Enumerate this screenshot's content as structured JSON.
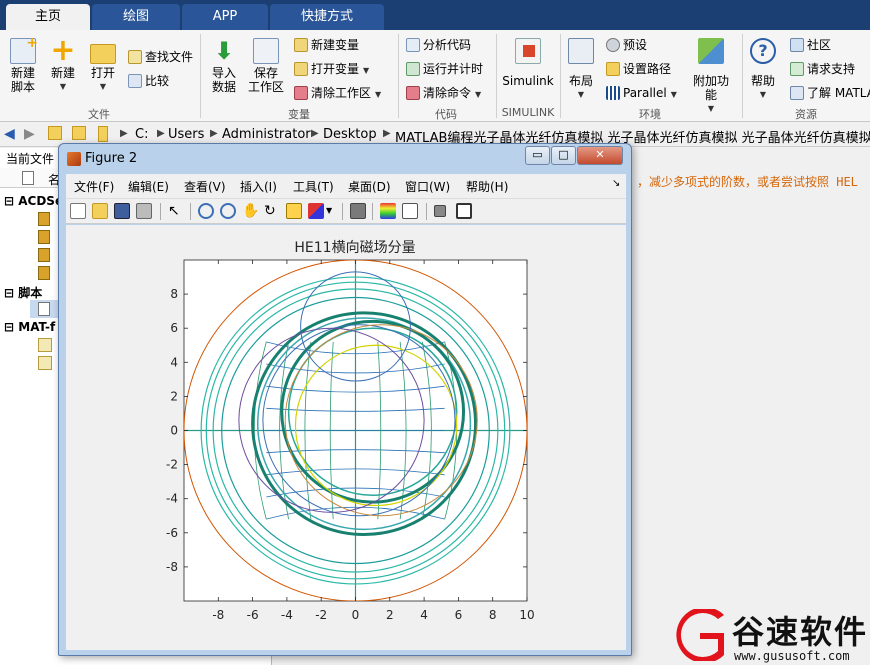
{
  "tabs": [
    {
      "label": "主页",
      "active": true
    },
    {
      "label": "绘图",
      "active": false
    },
    {
      "label": "APP",
      "active": false
    },
    {
      "label": "快捷方式",
      "active": false
    }
  ],
  "ribbon": {
    "file": {
      "new_script": "新建\n脚本",
      "new": "新建",
      "open": "打开",
      "find_files": "查找文件",
      "compare": "比较",
      "group": "文件"
    },
    "variable": {
      "import": "导入\n数据",
      "save_workspace": "保存\n工作区",
      "new_variable": "新建变量",
      "open_variable": "打开变量",
      "clear_workspace": "清除工作区",
      "group": "变量"
    },
    "code": {
      "analyze": "分析代码",
      "run_time": "运行并计时",
      "clear_commands": "清除命令",
      "group": "代码"
    },
    "simulink": {
      "label": "Simulink",
      "group": "SIMULINK"
    },
    "environment": {
      "layout": "布局",
      "preferences": "预设",
      "set_path": "设置路径",
      "parallel": "Parallel",
      "addons": "附加功能",
      "group": "环境"
    },
    "resources": {
      "help": "帮助",
      "community": "社区",
      "request_support": "请求支持",
      "learn": "了解 MATLAB",
      "group": "资源"
    }
  },
  "address": {
    "crumbs": [
      "C:",
      "Users",
      "Administrator",
      "Desktop",
      "MATLAB编程光子晶体光纤仿真模拟 光子晶体光纤仿真模拟 光子晶体光纤仿真模拟源码程"
    ]
  },
  "left_panel": {
    "title": "当前文件",
    "name_col": "名",
    "items": [
      "ACDSee",
      "脚本",
      "MAT-f"
    ]
  },
  "command": {
    "message": "，减少多项式的阶数，或者尝试按照 HEL"
  },
  "figure": {
    "title": "Figure 2",
    "menu": [
      "文件(F)",
      "编辑(E)",
      "查看(V)",
      "插入(I)",
      "工具(T)",
      "桌面(D)",
      "窗口(W)",
      "帮助(H)"
    ],
    "buttons": {
      "minimize": "▭",
      "maximize": "□",
      "close": "✕"
    }
  },
  "chart_data": {
    "type": "line",
    "title": "HE11横向磁场分量",
    "xlabel": "",
    "ylabel": "",
    "xlim": [
      -10,
      10
    ],
    "ylim": [
      -10,
      10
    ],
    "xticks": [
      -8,
      -6,
      -4,
      -2,
      0,
      2,
      4,
      6,
      8,
      10
    ],
    "yticks": [
      8,
      6,
      4,
      2,
      0,
      -2,
      -4,
      -6,
      -8
    ],
    "grid": false,
    "circles": [
      {
        "cx": 0,
        "cy": 0,
        "r": 10,
        "color": "#d35400",
        "width": 1
      },
      {
        "cx": 0,
        "cy": 0,
        "r": 9.0,
        "color": "#2bb8a8",
        "width": 1.2
      },
      {
        "cx": 0,
        "cy": 0,
        "r": 8.7,
        "color": "#2bb8a8",
        "width": 1.2
      },
      {
        "cx": 0,
        "cy": 0,
        "r": 8.3,
        "color": "#2bb8a8",
        "width": 1.2
      },
      {
        "cx": 0,
        "cy": 0,
        "r": 7.8,
        "color": "#1a9c9a",
        "width": 1.2
      },
      {
        "cx": 0.5,
        "cy": 0.4,
        "r": 6.5,
        "color": "#17806f",
        "width": 3
      },
      {
        "cx": 0.5,
        "cy": 0.4,
        "r": 6.2,
        "color": "#3aa8b0",
        "width": 1.5
      },
      {
        "cx": 1.0,
        "cy": 1.1,
        "r": 5.3,
        "color": "#17806f",
        "width": 3
      },
      {
        "cx": 1.0,
        "cy": 1.1,
        "r": 4.9,
        "color": "#2aa89a",
        "width": 1.5
      },
      {
        "cx": 1.2,
        "cy": 0.3,
        "r": 4.7,
        "color": "#d4d400",
        "width": 1.2
      },
      {
        "cx": 0.2,
        "cy": 0.6,
        "r": 5.6,
        "color": "#3b6fb6",
        "width": 1
      },
      {
        "cx": 1.5,
        "cy": 0.6,
        "r": 5.6,
        "color": "#c98a3c",
        "width": 1
      },
      {
        "cx": -1.4,
        "cy": 0.6,
        "r": 5.4,
        "color": "#6b4ca0",
        "width": 1
      },
      {
        "cx": 0,
        "cy": 6.1,
        "r": 3.2,
        "color": "#3b6fb6",
        "width": 1
      }
    ],
    "field_lines": {
      "color_vertical": "#2a9a6a",
      "color_horizontal": "#2a72b8",
      "count": 9,
      "extent": 5.2
    }
  }
}
